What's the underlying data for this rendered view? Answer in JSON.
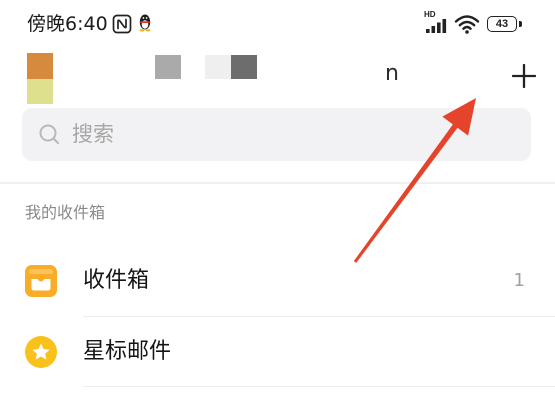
{
  "status_bar": {
    "time": "傍晚6:40",
    "network_label": "HD",
    "battery_level": "43",
    "icons": {
      "nfc": "nfc-icon",
      "qq": "qq-icon",
      "signal": "signal-icon",
      "wifi": "wifi-icon",
      "battery": "battery-icon"
    }
  },
  "header": {
    "account_text": "n",
    "add_icon": "plus-icon"
  },
  "search": {
    "icon": "search-icon",
    "placeholder": "搜索"
  },
  "section": {
    "title": "我的收件箱"
  },
  "folders": [
    {
      "label": "收件箱",
      "count": "1",
      "icon": "inbox-icon"
    },
    {
      "label": "星标邮件",
      "icon": "star-icon"
    }
  ],
  "colors": {
    "inbox_icon": "#f9ac27",
    "star_icon": "#f8c11c",
    "annotation_arrow": "#e5442b"
  }
}
